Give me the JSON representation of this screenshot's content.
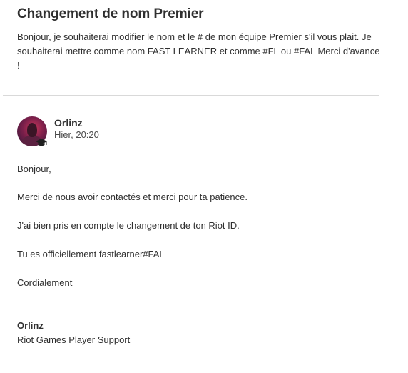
{
  "ticket": {
    "title": "Changement de nom Premier",
    "description": "Bonjour, je souhaiterai modifier le nom et le # de mon équipe Premier s'il vous plait. Je souhaiterai mettre comme nom FAST LEARNER et comme #FL ou #FAL Merci d'avance !"
  },
  "reply": {
    "author": "Orlinz",
    "timestamp": "Hier, 20:20",
    "avatar_icon": "user-avatar",
    "badge_icon": "graduation-cap-icon",
    "lines": [
      "Bonjour,",
      "Merci de nous avoir contactés et merci pour ta patience.",
      "J'ai bien pris en compte le changement de ton Riot ID.",
      "Tu es officiellement fastlearner#FAL",
      "Cordialement"
    ],
    "signature": {
      "name": "Orlinz",
      "team": "Riot Games Player Support"
    }
  }
}
